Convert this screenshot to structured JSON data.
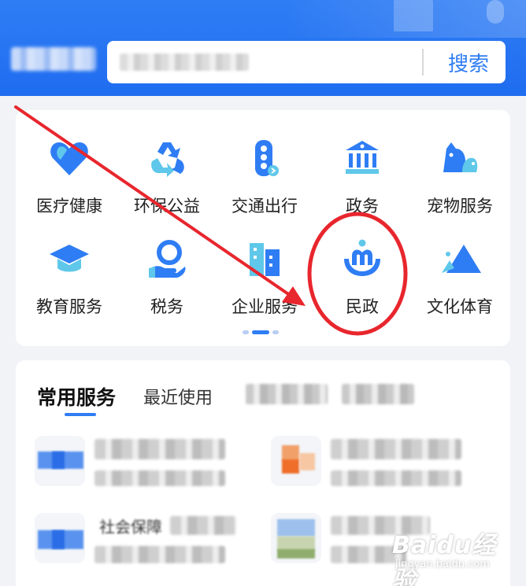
{
  "header": {
    "search_button": "搜索"
  },
  "categories": [
    {
      "label": "医疗健康",
      "icon": "heart-shield-icon"
    },
    {
      "label": "环保公益",
      "icon": "recycle-icon"
    },
    {
      "label": "交通出行",
      "icon": "traffic-light-icon"
    },
    {
      "label": "政务",
      "icon": "government-building-icon"
    },
    {
      "label": "宠物服务",
      "icon": "pet-icon"
    },
    {
      "label": "教育服务",
      "icon": "graduation-cap-icon"
    },
    {
      "label": "税务",
      "icon": "tax-hand-icon"
    },
    {
      "label": "企业服务",
      "icon": "office-building-icon"
    },
    {
      "label": "民政",
      "icon": "people-hands-icon"
    },
    {
      "label": "文化体育",
      "icon": "mountain-icon"
    }
  ],
  "services": {
    "tab_common": "常用服务",
    "tab_recent": "最近使用",
    "item_partial_title": "社会保障"
  },
  "colors": {
    "brand": "#2f7df4",
    "annotation": "#e8262d"
  },
  "watermark": {
    "main": "Baidu经验",
    "sub": "jingyan.baidu.com"
  }
}
